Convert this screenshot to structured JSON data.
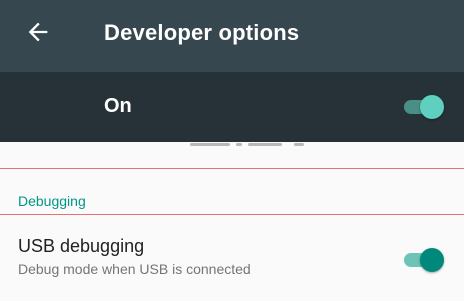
{
  "appbar": {
    "title": "Developer options",
    "back_icon": "arrow-back-icon",
    "background": "#37474f"
  },
  "master": {
    "label": "On",
    "checked": true,
    "background": "#263238"
  },
  "sections": [
    {
      "header": "Debugging",
      "header_color": "#009688",
      "items": [
        {
          "title": "USB debugging",
          "subtitle": "Debug mode when USB is connected",
          "checked": true
        }
      ]
    }
  ],
  "colors": {
    "accent": "#009688",
    "divider": "#e57373"
  }
}
